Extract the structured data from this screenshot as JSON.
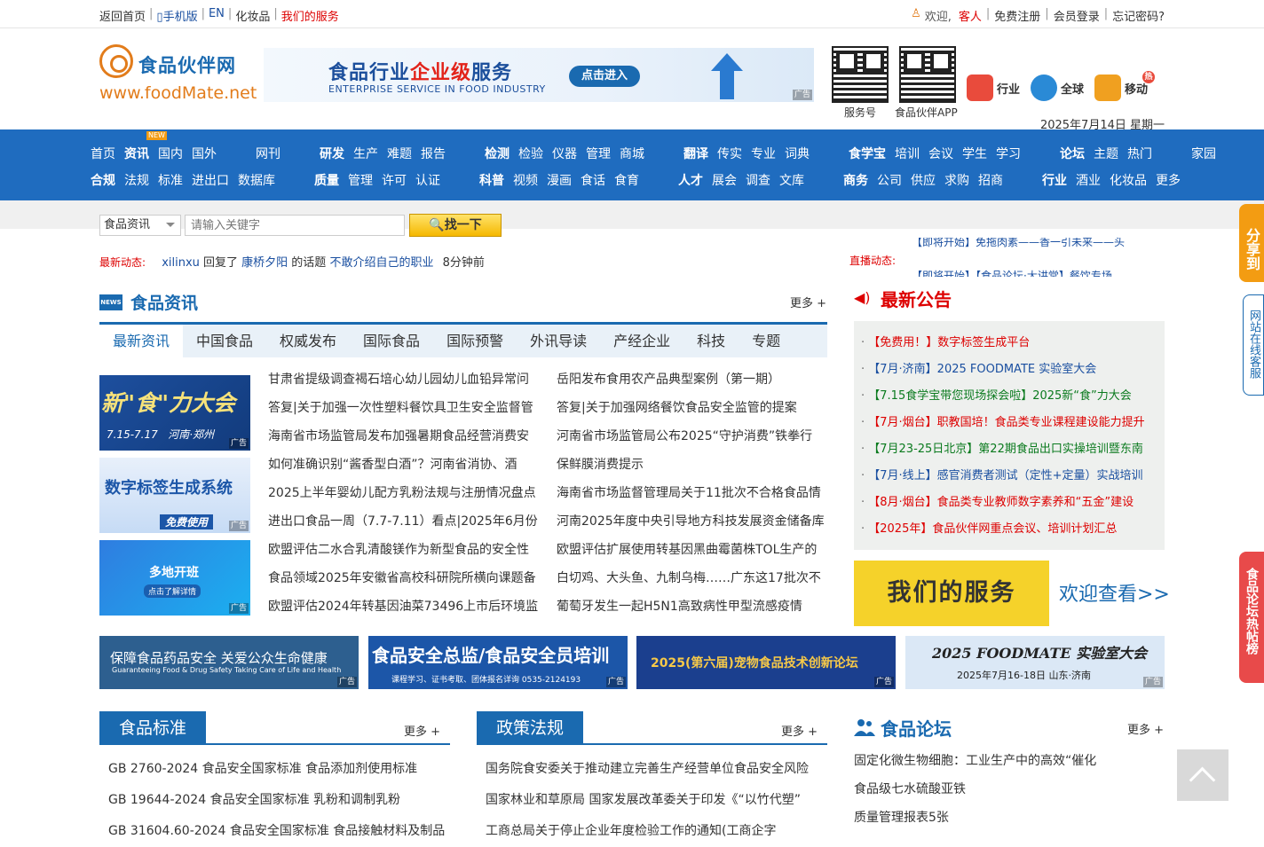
{
  "topbar": {
    "links": [
      "返回首页",
      "手机版",
      "EN",
      "化妆品",
      "我们的服务"
    ],
    "welcome": "欢迎,",
    "guest": "客人",
    "register": "免费注册",
    "login": "会员登录",
    "forgot": "忘记密码?"
  },
  "logo": {
    "cn": "食品伙伴网",
    "en": "www.foodMate.net"
  },
  "banner": {
    "title_a": "食品行业",
    "title_b": "企业级",
    "title_c": "服务",
    "subtitle": "ENTERPRISE SERVICE IN FOOD INDUSTRY",
    "button": "点击进入",
    "ad": "广告"
  },
  "qr": [
    {
      "label": "服务号"
    },
    {
      "label": "食品伙伴APP"
    }
  ],
  "header_icons": [
    {
      "label": "行业",
      "color": "#e94b3c"
    },
    {
      "label": "全球",
      "color": "#2a8ad6"
    },
    {
      "label": "移动",
      "color": "#f0a020"
    }
  ],
  "hot_badge": "热",
  "date": "2025年7月14日 星期一",
  "nav": {
    "row1": [
      {
        "bold": "首页",
        "items": []
      },
      {
        "bold": "资讯",
        "items": [
          "国内",
          "国外"
        ]
      },
      {
        "bold": "",
        "items": [
          "网刊"
        ]
      },
      {
        "bold": "研发",
        "items": [
          "生产",
          "难题",
          "报告"
        ]
      },
      {
        "bold": "检测",
        "items": [
          "检验",
          "仪器",
          "管理",
          "商城"
        ]
      },
      {
        "bold": "翻译",
        "items": [
          "传实",
          "专业",
          "词典"
        ]
      },
      {
        "bold": "食学宝",
        "items": [
          "培训",
          "会议",
          "学生",
          "学习"
        ]
      },
      {
        "bold": "论坛",
        "items": [
          "主题",
          "热门",
          "家园"
        ]
      }
    ],
    "row2": [
      {
        "bold": "合规",
        "items": [
          "法规",
          "标准",
          "进出口",
          "数据库"
        ]
      },
      {
        "bold": "质量",
        "items": [
          "管理",
          "许可",
          "认证"
        ]
      },
      {
        "bold": "科普",
        "items": [
          "视频",
          "漫画",
          "食话",
          "食育"
        ]
      },
      {
        "bold": "人才",
        "items": [
          "展会",
          "调查",
          "文库"
        ]
      },
      {
        "bold": "商务",
        "items": [
          "公司",
          "供应",
          "求购",
          "招商"
        ]
      },
      {
        "bold": "行业",
        "items": [
          "酒业",
          "化妆品",
          "更多"
        ]
      }
    ],
    "new_badge": "NEW"
  },
  "search": {
    "select": "食品资讯",
    "placeholder": "请输入关键字",
    "button": "找一下"
  },
  "dynamic": {
    "label": "最新动态:",
    "user": "xilinxu",
    "action": " 回复了 ",
    "target": "康桥夕阳",
    "mid": " 的话题 ",
    "topic": "不敢介绍自己的职业",
    "time": "8分钟前"
  },
  "live": {
    "label": "直播动态:",
    "line1": "【即将开始】免拖肉素——香一引未来——头",
    "line2": "【即将开始】【食品论坛·大讲堂】餐饮专场"
  },
  "news": {
    "title": "食品资讯",
    "more": "更多 +",
    "news_icon": "NEWS",
    "tabs": [
      "最新资讯",
      "中国食品",
      "权威发布",
      "国际食品",
      "国际预警",
      "外讯导读",
      "产经企业",
      "科技",
      "专题"
    ],
    "col1": [
      "甘肃省提级调查褐石培心幼儿园幼儿血铅异常问",
      "答复|关于加强一次性塑料餐饮具卫生安全监督管",
      "海南省市场监管局发布加强暑期食品经营消费安",
      "如何准确识别“酱香型白酒”？河南省消协、酒",
      "2025上半年婴幼儿配方乳粉法规与注册情况盘点",
      "进出口食品一周（7.7-7.11）看点|2025年6月份",
      "欧盟评估二水合乳清酸镁作为新型食品的安全性",
      "食品领域2025年安徽省高校科研院所横向课题备",
      "欧盟评估2024年转基因油菜73496上市后环境监"
    ],
    "col2": [
      "岳阳发布食用农产品典型案例（第一期）",
      "答复|关于加强网络餐饮食品安全监管的提案",
      "河南省市场监管局公布2025“守护消费”铁拳行",
      "保鲜膜消费提示",
      "海南省市场监督管理局关于11批次不合格食品情",
      "河南2025年度中央引导地方科技发展资金储备库",
      "欧盟评估扩展使用转基因黑曲霉菌株TOL生产的",
      "白切鸡、大头鱼、九制乌梅……广东这17批次不",
      "葡萄牙发生一起H5N1高致病性甲型流感疫情"
    ],
    "thumbs": [
      {
        "text": "新\"食\"力大会",
        "sub": "7.15-7.17   河南·郑州"
      },
      {
        "text": "数字标签生成系统",
        "sub": "免费使用"
      },
      {
        "text": "多地开班",
        "sub": "点击了解详情"
      }
    ]
  },
  "announce": {
    "title": "最新公告",
    "items": [
      {
        "text": "【免费用！】数字标签生成平台",
        "color": "red"
      },
      {
        "text": "【7月·济南】2025 FOODMATE 实验室大会",
        "color": "blue"
      },
      {
        "text": "【7.15食学宝带您现场探会啦】2025新“食”力大会",
        "color": "green"
      },
      {
        "text": "【7月·烟台】职教国培！食品类专业课程建设能力提升",
        "color": "red"
      },
      {
        "text": "【7月23-25日北京】第22期食品出口实操培训暨东南",
        "color": "green"
      },
      {
        "text": "【7月·线上】感官消费者测试（定性+定量）实战培训",
        "color": "blue"
      },
      {
        "text": "【8月·烟台】食品类专业教师数字素养和“五金”建设",
        "color": "red"
      },
      {
        "text": "【2025年】食品伙伴网重点会议、培训计划汇总",
        "color": "red"
      }
    ],
    "service": "我们的服务",
    "welcome": "欢迎查看>>"
  },
  "ads": [
    {
      "l1": "保障食品药品安全  关爱公众生命健康",
      "l2": "Guaranteeing Food & Drug Safety  Taking Care of Life and Health",
      "bg": "#2d5f8f"
    },
    {
      "l1": "食品安全总监/食品安全员培训",
      "l2": "课程学习、证书考取、团体报名详询 0535-2124193",
      "bg": "#1c56a8"
    },
    {
      "l1": "2025(第六届)宠物食品技术创新论坛",
      "l2": "",
      "bg": "#1b3f8e"
    },
    {
      "l1": "2025 FOODMATE 实验室大会",
      "l2": "2025年7月16-18日  山东·济南",
      "bg": "#dbe8f6"
    }
  ],
  "standards": {
    "title": "食品标准",
    "more": "更多 +",
    "items": [
      "GB 2760-2024 食品安全国家标准 食品添加剂使用标准",
      "GB 19644-2024 食品安全国家标准 乳粉和调制乳粉",
      "GB 31604.60-2024 食品安全国家标准 食品接触材料及制品"
    ]
  },
  "policy": {
    "title": "政策法规",
    "more": "更多 +",
    "items": [
      "国务院食安委关于推动建立完善生产经营单位食品安全风险",
      "国家林业和草原局 国家发展改革委关于印发《“以竹代塑”",
      "工商总局关于停止企业年度检验工作的通知(工商企字"
    ]
  },
  "forum": {
    "title": "食品论坛",
    "more": "更多 +",
    "items": [
      "固定化微生物细胞：工业生产中的高效“催化",
      "食品级七水硫酸亚铁",
      "质量管理报表5张"
    ]
  },
  "side": {
    "share": "分享到",
    "service": "网站在线客服",
    "hot": "食品论坛热帖榜"
  }
}
